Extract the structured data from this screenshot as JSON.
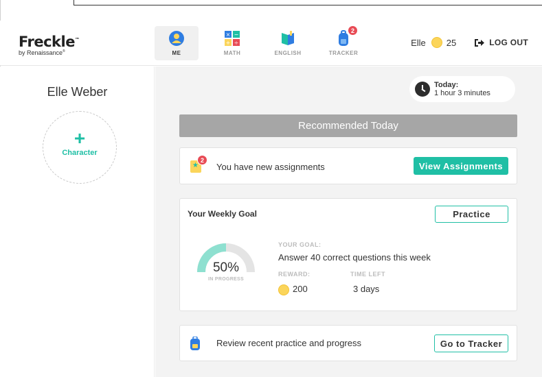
{
  "header": {
    "logo_text": "Freckle",
    "logo_tm": "™",
    "logo_sub": "by Renaissance",
    "logo_reg": "®",
    "nav": [
      {
        "label": "ME",
        "icon": "person-icon",
        "active": true
      },
      {
        "label": "MATH",
        "icon": "math-icon",
        "active": false
      },
      {
        "label": "ENGLISH",
        "icon": "book-icon",
        "active": false
      },
      {
        "label": "TRACKER",
        "icon": "backpack-icon",
        "active": false,
        "badge": "2"
      }
    ],
    "user_name": "Elle",
    "coins": "25",
    "logout_label": "LOG OUT"
  },
  "sidebar": {
    "student_name": "Elle Weber",
    "character_plus": "+",
    "character_label": "Character"
  },
  "main": {
    "today_label": "Today:",
    "today_value": "1 hour 3 minutes",
    "recommended_title": "Recommended Today",
    "assignments": {
      "badge": "2",
      "text": "You have new assignments",
      "button": "View Assignments"
    },
    "weekly_goal": {
      "title": "Your Weekly Goal",
      "button": "Practice",
      "progress_percent": 50,
      "percent_text": "50%",
      "status": "IN PROGRESS",
      "goal_label": "YOUR GOAL:",
      "goal_text": "Answer 40 correct questions this week",
      "reward_label": "REWARD:",
      "reward_value": "200",
      "time_left_label": "TIME LEFT",
      "time_left_value": "3 days"
    },
    "tracker": {
      "text": "Review recent practice and progress",
      "button": "Go to Tracker"
    }
  },
  "colors": {
    "accent": "#1fbfa5",
    "badge": "#e84b55",
    "coin": "#fbd55b",
    "recommended_bar": "#a6a6a6"
  }
}
